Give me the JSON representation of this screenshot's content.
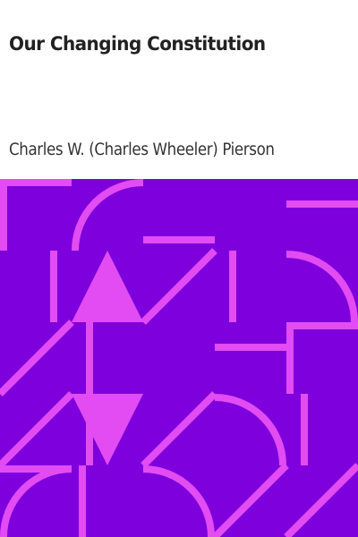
{
  "book": {
    "title": "Our Changing Constitution",
    "author": "Charles W. (Charles Wheeler) Pierson"
  },
  "colors": {
    "header_background": "#ffffff",
    "title_text": "#222222",
    "author_text": "#333333",
    "pattern_background": "#7e00dc",
    "pattern_foreground": "#e24cf2"
  }
}
